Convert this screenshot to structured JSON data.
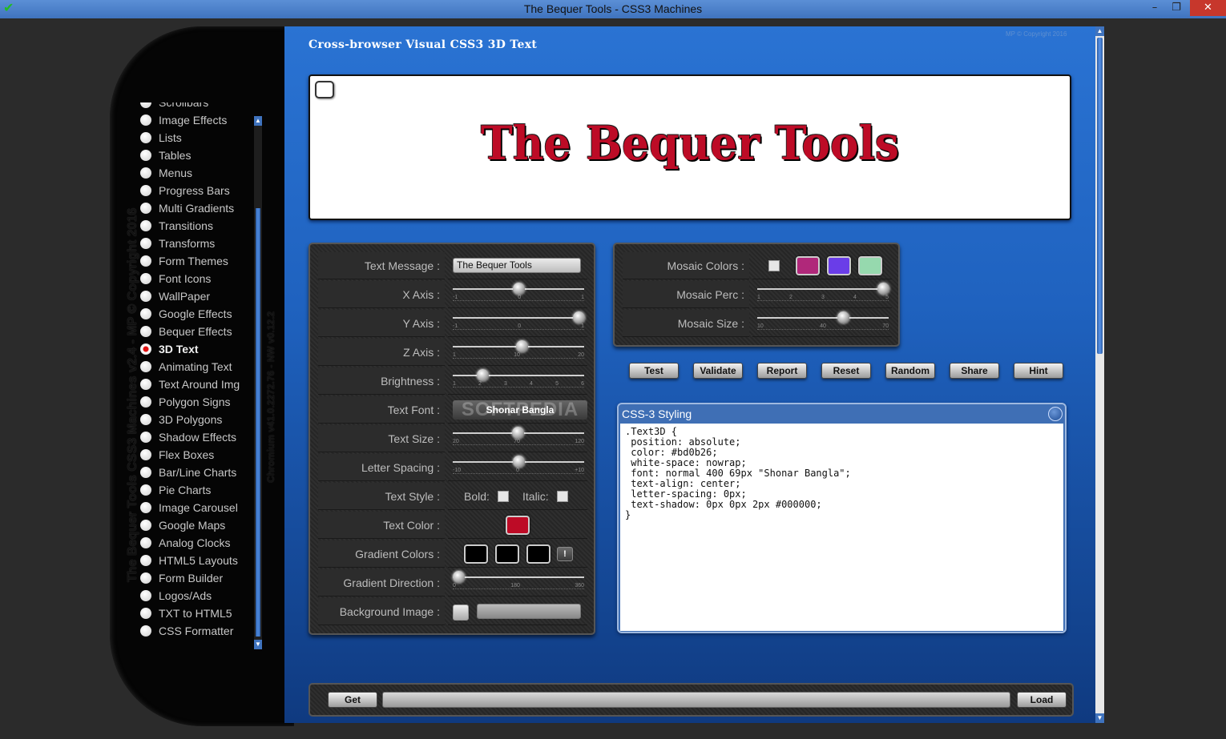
{
  "window": {
    "title": "The Bequer Tools - CSS3 Machines",
    "controls": [
      "–",
      "❐",
      "✕"
    ]
  },
  "sidebar": {
    "vertical_title": "The Bequer Tools CSS3 Machines v2.4 - MP © Copyright 2016",
    "vertical_subtitle": "Chromium v41.0.2272.76 - NW v0.12.2",
    "items": [
      {
        "label": "Scrollbars"
      },
      {
        "label": "Image Effects"
      },
      {
        "label": "Lists"
      },
      {
        "label": "Tables"
      },
      {
        "label": "Menus"
      },
      {
        "label": "Progress Bars"
      },
      {
        "label": "Multi Gradients"
      },
      {
        "label": "Transitions"
      },
      {
        "label": "Transforms"
      },
      {
        "label": "Form Themes"
      },
      {
        "label": "Font Icons"
      },
      {
        "label": "WallPaper"
      },
      {
        "label": "Google Effects"
      },
      {
        "label": "Bequer Effects"
      },
      {
        "label": "3D Text"
      },
      {
        "label": "Animating Text"
      },
      {
        "label": "Text Around Img"
      },
      {
        "label": "Polygon Signs"
      },
      {
        "label": "3D Polygons"
      },
      {
        "label": "Shadow Effects"
      },
      {
        "label": "Flex Boxes"
      },
      {
        "label": "Bar/Line Charts"
      },
      {
        "label": "Pie Charts"
      },
      {
        "label": "Image Carousel"
      },
      {
        "label": "Google Maps"
      },
      {
        "label": "Analog Clocks"
      },
      {
        "label": "HTML5 Layouts"
      },
      {
        "label": "Form Builder"
      },
      {
        "label": "Logos/Ads"
      },
      {
        "label": "TXT to HTML5"
      },
      {
        "label": "CSS Formatter"
      }
    ],
    "selected": "3D Text"
  },
  "main": {
    "heading": "Cross-browser Visual CSS3 3D Text",
    "copyright": "MP © Copyright 2016",
    "preview_text": "The Bequer Tools",
    "preview_color": "#bd0b26"
  },
  "settings": {
    "text_message": {
      "label": "Text Message :",
      "value": "The Bequer Tools"
    },
    "x_axis": {
      "label": "X Axis :",
      "ticks": [
        "-1",
        "0",
        "1"
      ],
      "value": 0
    },
    "y_axis": {
      "label": "Y Axis :",
      "ticks": [
        "-1",
        "0",
        "1"
      ],
      "value": 1
    },
    "z_axis": {
      "label": "Z Axis :",
      "ticks": [
        "1",
        "10",
        "20"
      ],
      "value": 11
    },
    "brightness": {
      "label": "Brightness :",
      "ticks": [
        "1",
        "2",
        "3",
        "4",
        "5",
        "6"
      ],
      "value": 2
    },
    "text_font": {
      "label": "Text Font :",
      "value": "Shonar Bangla",
      "watermark": "SOFTPEDIA"
    },
    "text_size": {
      "label": "Text Size :",
      "ticks": [
        "20",
        "70",
        "120"
      ],
      "value": 69
    },
    "letter_spacing": {
      "label": "Letter Spacing :",
      "ticks": [
        "-10",
        "0",
        "+10"
      ],
      "value": 0
    },
    "text_style": {
      "label": "Text Style :",
      "bold_label": "Bold:",
      "italic_label": "Italic:"
    },
    "text_color": {
      "label": "Text Color :",
      "color": "#bd0b26"
    },
    "gradient_colors": {
      "label": "Gradient Colors :",
      "colors": [
        "#000000",
        "#000000",
        "#000000"
      ],
      "button": "!"
    },
    "gradient_direction": {
      "label": "Gradient Direction :",
      "ticks": [
        "0",
        "180",
        "360"
      ],
      "value": 0
    },
    "background_image": {
      "label": "Background Image :"
    }
  },
  "mosaic": {
    "colors": {
      "label": "Mosaic Colors :",
      "swatches": [
        "#b0287a",
        "#6a3de8",
        "#96d9ae"
      ]
    },
    "perc": {
      "label": "Mosaic Perc :",
      "ticks": [
        "1",
        "2",
        "3",
        "4",
        "5"
      ],
      "value": 5
    },
    "size": {
      "label": "Mosaic Size :",
      "ticks": [
        "10",
        "40",
        "70"
      ],
      "value": 50
    }
  },
  "actions": [
    "Test",
    "Validate",
    "Report",
    "Reset",
    "Random",
    "Share",
    "Hint"
  ],
  "css_box": {
    "title": "CSS-3 Styling",
    "code": ".Text3D {\n position: absolute;\n color: #bd0b26;\n white-space: nowrap;\n font: normal 400 69px \"Shonar Bangla\";\n text-align: center;\n letter-spacing: 0px;\n text-shadow: 0px 0px 2px #000000;\n}"
  },
  "bottom": {
    "get_label": "Get",
    "load_label": "Load"
  }
}
